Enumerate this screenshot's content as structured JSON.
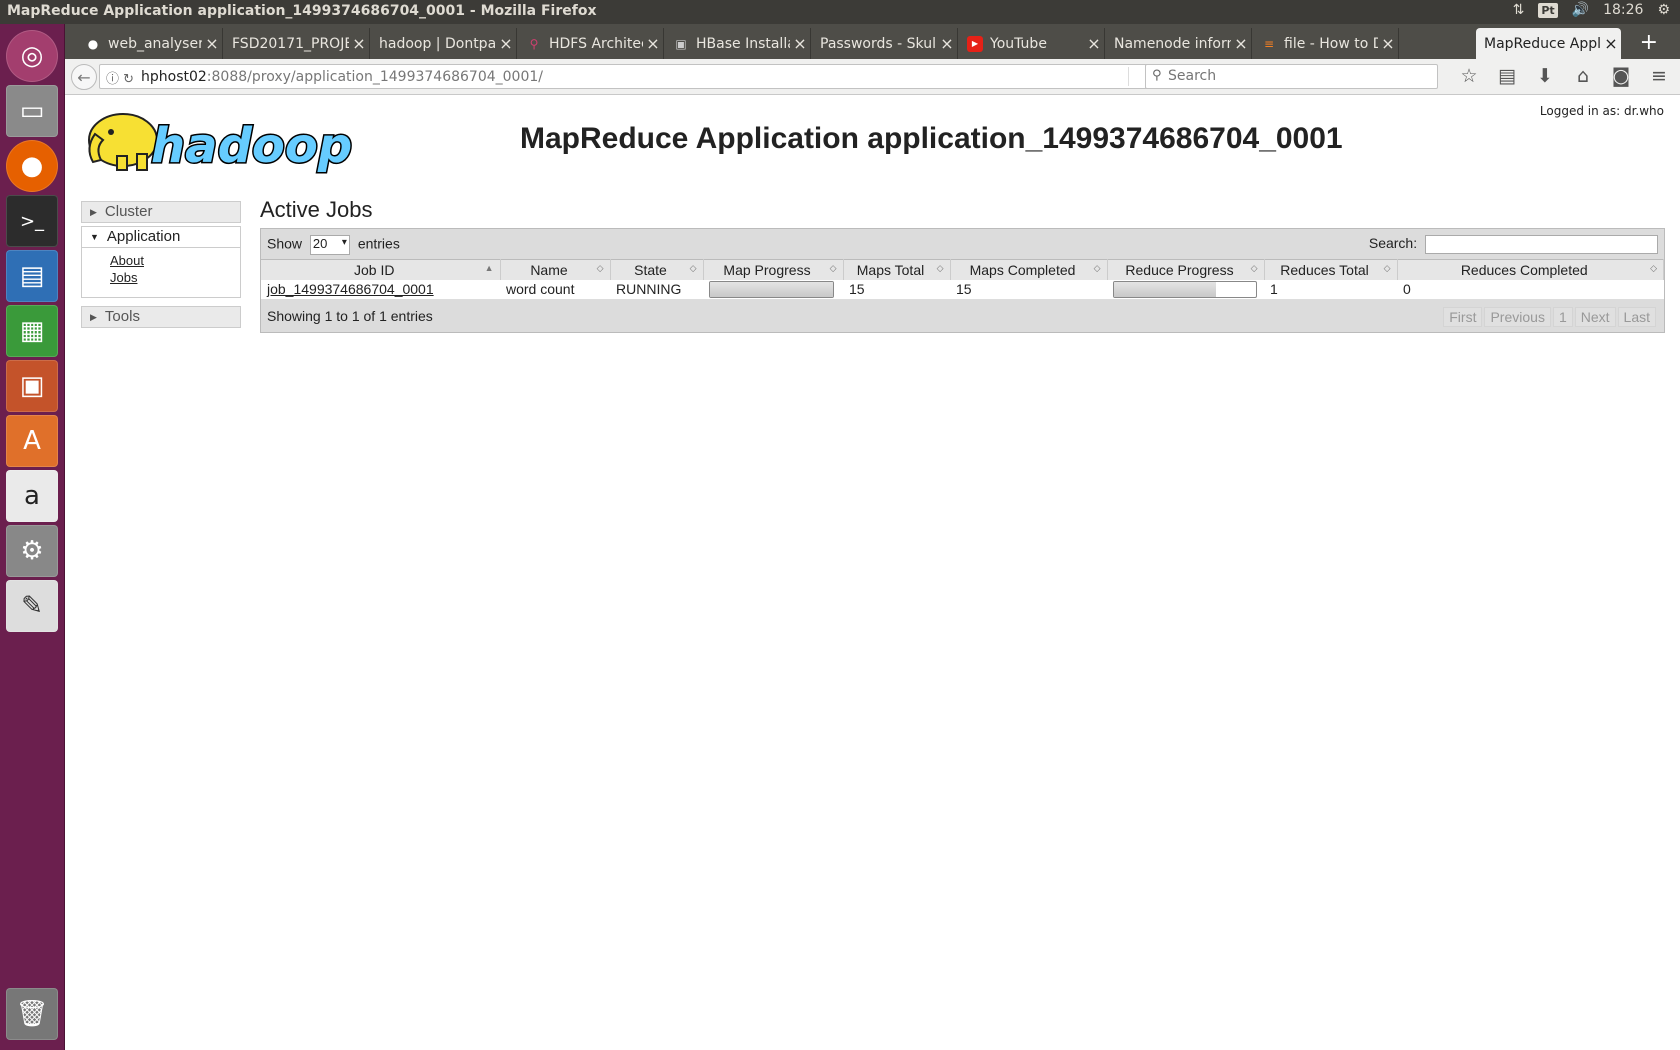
{
  "window": {
    "title": "MapReduce Application application_1499374686704_0001 - Mozilla Firefox"
  },
  "system_tray": {
    "keyboard": "Pt",
    "time": "18:26"
  },
  "tabs": [
    {
      "label": "web_analyser/",
      "icon": "github-icon"
    },
    {
      "label": "FSD20171_PROJE",
      "icon": ""
    },
    {
      "label": "hadoop | Dontpa",
      "icon": ""
    },
    {
      "label": "HDFS Architec",
      "icon": "hdfs-icon"
    },
    {
      "label": "HBase Installa",
      "icon": "hbase-icon"
    },
    {
      "label": "Passwords - Skull",
      "icon": ""
    },
    {
      "label": "YouTube",
      "icon": "youtube-icon"
    },
    {
      "label": "Namenode inforn",
      "icon": ""
    },
    {
      "label": "file - How to D",
      "icon": "stackoverflow-icon"
    },
    {
      "label": "MapReduce Appli",
      "icon": ""
    }
  ],
  "urlbar": {
    "host": "hphost02",
    "path": ":8088/proxy/application_1499374686704_0001/"
  },
  "searchbar": {
    "placeholder": "Search"
  },
  "page": {
    "logged_in": "Logged in as: dr.who",
    "title": "MapReduce Application application_1499374686704_0001"
  },
  "nav": {
    "cluster": "Cluster",
    "application": "Application",
    "about": "About",
    "jobs": "Jobs",
    "tools": "Tools"
  },
  "jobs": {
    "heading": "Active Jobs",
    "show_label": "Show",
    "page_size": "20",
    "entries_label": "entries",
    "search_label": "Search:",
    "columns": [
      "Job ID",
      "Name",
      "State",
      "Map Progress",
      "Maps Total",
      "Maps Completed",
      "Reduce Progress",
      "Reduces Total",
      "Reduces Completed"
    ],
    "rows": [
      {
        "job_id": "job_1499374686704_0001",
        "name": "word count",
        "state": "RUNNING",
        "map_progress_pct": 100,
        "maps_total": "15",
        "maps_completed": "15",
        "reduce_progress_pct": 72,
        "reduces_total": "1",
        "reduces_completed": "0"
      }
    ],
    "info": "Showing 1 to 1 of 1 entries",
    "pager": {
      "first": "First",
      "previous": "Previous",
      "page": "1",
      "next": "Next",
      "last": "Last"
    }
  }
}
